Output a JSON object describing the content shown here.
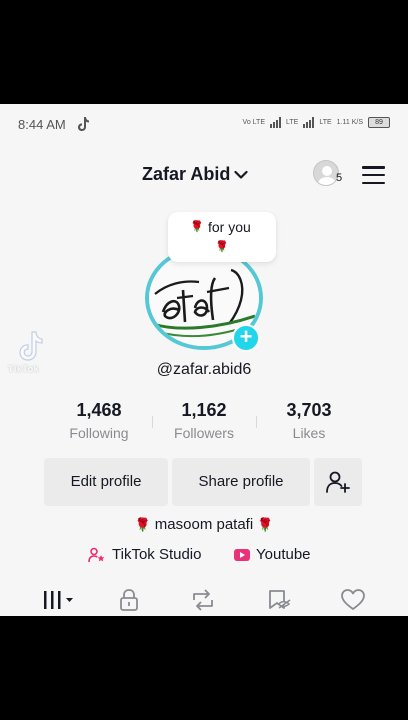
{
  "status_bar": {
    "time": "8:44 AM",
    "network": [
      "Vo LTE",
      "LTE",
      "LTE"
    ],
    "speed": "1.11 K/S",
    "battery": "89"
  },
  "header": {
    "username": "Zafar Abid",
    "notification_count": "5"
  },
  "profile": {
    "note_text": "for you",
    "handle": "@zafar.abid6",
    "photo_caption": "patafi"
  },
  "watermark": {
    "text": "TikTok"
  },
  "stats": {
    "following": {
      "value": "1,468",
      "label": "Following"
    },
    "followers": {
      "value": "1,162",
      "label": "Followers"
    },
    "likes": {
      "value": "3,703",
      "label": "Likes"
    }
  },
  "buttons": {
    "edit_profile": "Edit profile",
    "share_profile": "Share profile"
  },
  "bio": {
    "text": "masoom patafi"
  },
  "links": {
    "studio": "TikTok Studio",
    "youtube": "Youtube"
  },
  "tabs": [
    "videos-grid-icon",
    "lock-icon",
    "repost-icon",
    "favorites-icon",
    "liked-heart-icon"
  ],
  "colors": {
    "accent": "#20d5ec",
    "ring": "#55c8d6",
    "rose": "#b0121c",
    "youtube": "#e8337a",
    "studio": "#ee2d6d"
  }
}
